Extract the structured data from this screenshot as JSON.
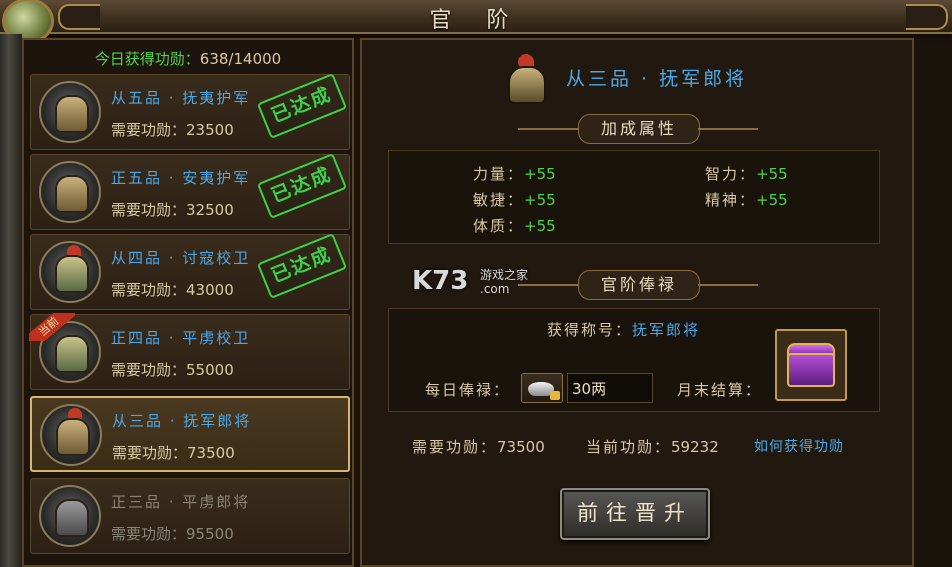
{
  "window": {
    "title": "官 阶"
  },
  "today": {
    "label": "今日获得功勋：",
    "value": "638/14000"
  },
  "ranks": [
    {
      "name": "从五品 · 抚夷护军",
      "req_label": "需要功勋：",
      "req": "23500",
      "stamp": "已达成"
    },
    {
      "name": "正五品 · 安夷护军",
      "req_label": "需要功勋：",
      "req": "32500",
      "stamp": "已达成"
    },
    {
      "name": "从四品 · 讨寇校卫",
      "req_label": "需要功勋：",
      "req": "43000",
      "stamp": "已达成"
    },
    {
      "name": "正四品 · 平虏校卫",
      "req_label": "需要功勋：",
      "req": "55000",
      "ribbon": "当前"
    },
    {
      "name": "从三品 · 抚军郎将",
      "req_label": "需要功勋：",
      "req": "73500"
    },
    {
      "name": "正三品 · 平虏郎将",
      "req_label": "需要功勋：",
      "req": "95500"
    }
  ],
  "detail": {
    "title": "从三品 · 抚军郎将",
    "bonus_header": "加成属性",
    "attrs": [
      {
        "label": "力量：",
        "value": "+55"
      },
      {
        "label": "智力：",
        "value": "+55"
      },
      {
        "label": "敏捷：",
        "value": "+55"
      },
      {
        "label": "精神：",
        "value": "+55"
      },
      {
        "label": "体质：",
        "value": "+55"
      }
    ],
    "salary_header": "官阶俸禄",
    "title_label": "获得称号：",
    "title_value": "抚军郎将",
    "daily_label": "每日俸禄：",
    "daily_value": "30两",
    "month_label": "月末结算：",
    "need_label": "需要功勋：",
    "need_value": "73500",
    "current_label": "当前功勋：",
    "current_value": "59232",
    "how_link": "如何获得功勋",
    "go_button": "前往晋升"
  },
  "watermark": {
    "main": "K73",
    "sub1": "游戏之家",
    "sub2": ".com"
  },
  "colors": {
    "accent_blue": "#4aa8e8",
    "accent_green": "#4fd34a",
    "stamp_green": "#3bd14a"
  }
}
